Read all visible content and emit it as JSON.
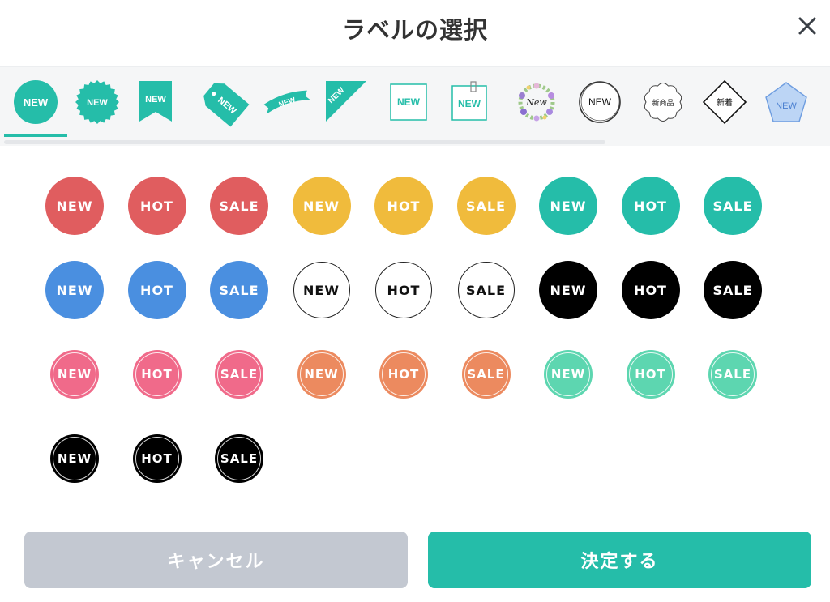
{
  "dialog": {
    "title": "ラベルの選択",
    "close_icon": "close-icon"
  },
  "tabs": [
    {
      "name": "tab-circle-new",
      "text": "NEW",
      "selected": true
    },
    {
      "name": "tab-burst-new",
      "text": "NEW"
    },
    {
      "name": "tab-banner-new",
      "text": "NEW"
    },
    {
      "name": "tab-tag-new",
      "text": "NEW"
    },
    {
      "name": "tab-ribbon-new",
      "text": "NEW"
    },
    {
      "name": "tab-corner-new",
      "text": "NEW"
    },
    {
      "name": "tab-frame-new",
      "text": "NEW"
    },
    {
      "name": "tab-clip-frame-new",
      "text": "NEW"
    },
    {
      "name": "tab-floral-wreath-new",
      "text": "New"
    },
    {
      "name": "tab-sketch-circle-new",
      "text": "NEW"
    },
    {
      "name": "tab-scallop-shinshohin",
      "text": "新商品"
    },
    {
      "name": "tab-diamond-shinchaku",
      "text": "新着"
    },
    {
      "name": "tab-pentagon-new",
      "text": "NEW"
    }
  ],
  "colors": {
    "accent": "#25bda9",
    "red": "#e05d5f",
    "yellow": "#f0bb3c",
    "teal": "#25bda9",
    "blue": "#4a8fe0",
    "black": "#000000",
    "pink": "#f06a8a",
    "orange": "#ec8a5f",
    "mint": "#5dd6b0",
    "cancel_bg": "#c3c8d1"
  },
  "labels": [
    {
      "text": "NEW",
      "style": "flat",
      "color": "#e05d5f"
    },
    {
      "text": "HOT",
      "style": "flat",
      "color": "#e05d5f"
    },
    {
      "text": "SALE",
      "style": "flat",
      "color": "#e05d5f"
    },
    {
      "text": "NEW",
      "style": "flat",
      "color": "#f0bb3c"
    },
    {
      "text": "HOT",
      "style": "flat",
      "color": "#f0bb3c"
    },
    {
      "text": "SALE",
      "style": "flat",
      "color": "#f0bb3c"
    },
    {
      "text": "NEW",
      "style": "flat",
      "color": "#25bda9"
    },
    {
      "text": "HOT",
      "style": "flat",
      "color": "#25bda9"
    },
    {
      "text": "SALE",
      "style": "flat",
      "color": "#25bda9"
    },
    {
      "text": "NEW",
      "style": "flat",
      "color": "#4a8fe0"
    },
    {
      "text": "HOT",
      "style": "flat",
      "color": "#4a8fe0"
    },
    {
      "text": "SALE",
      "style": "flat",
      "color": "#4a8fe0"
    },
    {
      "text": "NEW",
      "style": "outline",
      "color": "#ffffff"
    },
    {
      "text": "HOT",
      "style": "outline",
      "color": "#ffffff"
    },
    {
      "text": "SALE",
      "style": "outline",
      "color": "#ffffff"
    },
    {
      "text": "NEW",
      "style": "flat",
      "color": "#000000"
    },
    {
      "text": "HOT",
      "style": "flat",
      "color": "#000000"
    },
    {
      "text": "SALE",
      "style": "flat",
      "color": "#000000"
    },
    {
      "text": "NEW",
      "style": "ring",
      "color": "#f06a8a"
    },
    {
      "text": "HOT",
      "style": "ring",
      "color": "#f06a8a"
    },
    {
      "text": "SALE",
      "style": "ring",
      "color": "#f06a8a"
    },
    {
      "text": "NEW",
      "style": "ring",
      "color": "#ec8a5f"
    },
    {
      "text": "HOT",
      "style": "ring",
      "color": "#ec8a5f"
    },
    {
      "text": "SALE",
      "style": "ring",
      "color": "#ec8a5f"
    },
    {
      "text": "NEW",
      "style": "ring",
      "color": "#5dd6b0"
    },
    {
      "text": "HOT",
      "style": "ring",
      "color": "#5dd6b0"
    },
    {
      "text": "SALE",
      "style": "ring",
      "color": "#5dd6b0"
    },
    {
      "text": "NEW",
      "style": "ring",
      "color": "#000000"
    },
    {
      "text": "HOT",
      "style": "ring",
      "color": "#000000"
    },
    {
      "text": "SALE",
      "style": "ring",
      "color": "#000000"
    }
  ],
  "footer": {
    "cancel_label": "キャンセル",
    "confirm_label": "決定する"
  }
}
